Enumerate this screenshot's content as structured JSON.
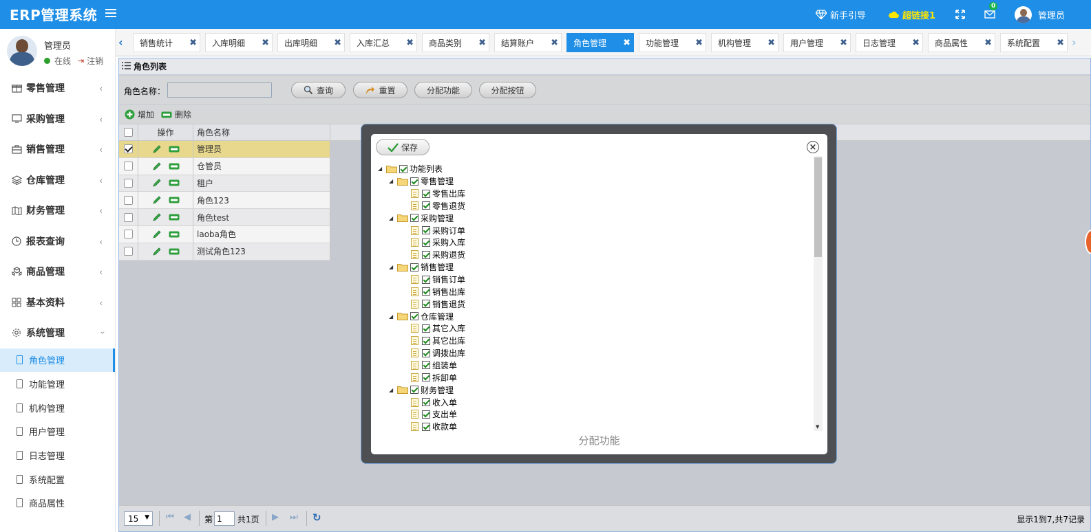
{
  "app": {
    "title": "ERP管理系统"
  },
  "topbar": {
    "guide": "新手引导",
    "link": "超链接1",
    "msg_count": "0",
    "user": "管理员"
  },
  "sidebar": {
    "user": {
      "name": "管理员",
      "online": "在线",
      "logout": "注销"
    },
    "items": [
      {
        "label": "零售管理"
      },
      {
        "label": "采购管理"
      },
      {
        "label": "销售管理"
      },
      {
        "label": "仓库管理"
      },
      {
        "label": "财务管理"
      },
      {
        "label": "报表查询"
      },
      {
        "label": "商品管理"
      },
      {
        "label": "基本资料"
      },
      {
        "label": "系统管理"
      }
    ],
    "sub_items": [
      {
        "label": "角色管理"
      },
      {
        "label": "功能管理"
      },
      {
        "label": "机构管理"
      },
      {
        "label": "用户管理"
      },
      {
        "label": "日志管理"
      },
      {
        "label": "系统配置"
      },
      {
        "label": "商品属性"
      }
    ]
  },
  "tabs": [
    {
      "label": "销售统计"
    },
    {
      "label": "入库明细"
    },
    {
      "label": "出库明细"
    },
    {
      "label": "入库汇总"
    },
    {
      "label": "商品类别"
    },
    {
      "label": "结算账户"
    },
    {
      "label": "角色管理"
    },
    {
      "label": "功能管理"
    },
    {
      "label": "机构管理"
    },
    {
      "label": "用户管理"
    },
    {
      "label": "日志管理"
    },
    {
      "label": "商品属性"
    },
    {
      "label": "系统配置"
    }
  ],
  "panel": {
    "title": "角色列表",
    "search_label": "角色名称：",
    "search_value": "",
    "buttons": {
      "query": "查询",
      "reset": "重置",
      "assign_func": "分配功能",
      "assign_btn": "分配按钮"
    },
    "toolbar": {
      "add": "增加",
      "delete": "删除"
    },
    "columns": {
      "ops": "操作",
      "name": "角色名称"
    },
    "rows": [
      {
        "name": "管理员",
        "checked": true
      },
      {
        "name": "仓管员",
        "checked": false
      },
      {
        "name": "租户",
        "checked": false
      },
      {
        "name": "角色123",
        "checked": false
      },
      {
        "name": "角色test",
        "checked": false
      },
      {
        "name": "laoba角色",
        "checked": false
      },
      {
        "name": "测试角色123",
        "checked": false
      }
    ]
  },
  "pager": {
    "page_size": "15",
    "page_prefix": "第",
    "page_value": "1",
    "page_suffix": "共1页",
    "summary": "显示1到7,共7记录"
  },
  "dialog": {
    "title": "分配功能",
    "save": "保存",
    "tree": {
      "root": "功能列表",
      "groups": [
        {
          "label": "零售管理",
          "children": [
            "零售出库",
            "零售退货"
          ]
        },
        {
          "label": "采购管理",
          "children": [
            "采购订单",
            "采购入库",
            "采购退货"
          ]
        },
        {
          "label": "销售管理",
          "children": [
            "销售订单",
            "销售出库",
            "销售退货"
          ]
        },
        {
          "label": "仓库管理",
          "children": [
            "其它入库",
            "其它出库",
            "调拨出库",
            "组装单",
            "拆卸单"
          ]
        },
        {
          "label": "财务管理",
          "children": [
            "收入单",
            "支出单",
            "收款单"
          ]
        }
      ]
    }
  },
  "colors": {
    "primary": "#1e8ee6",
    "highlight": "#e8d88d",
    "link_yellow": "#ffe600"
  }
}
